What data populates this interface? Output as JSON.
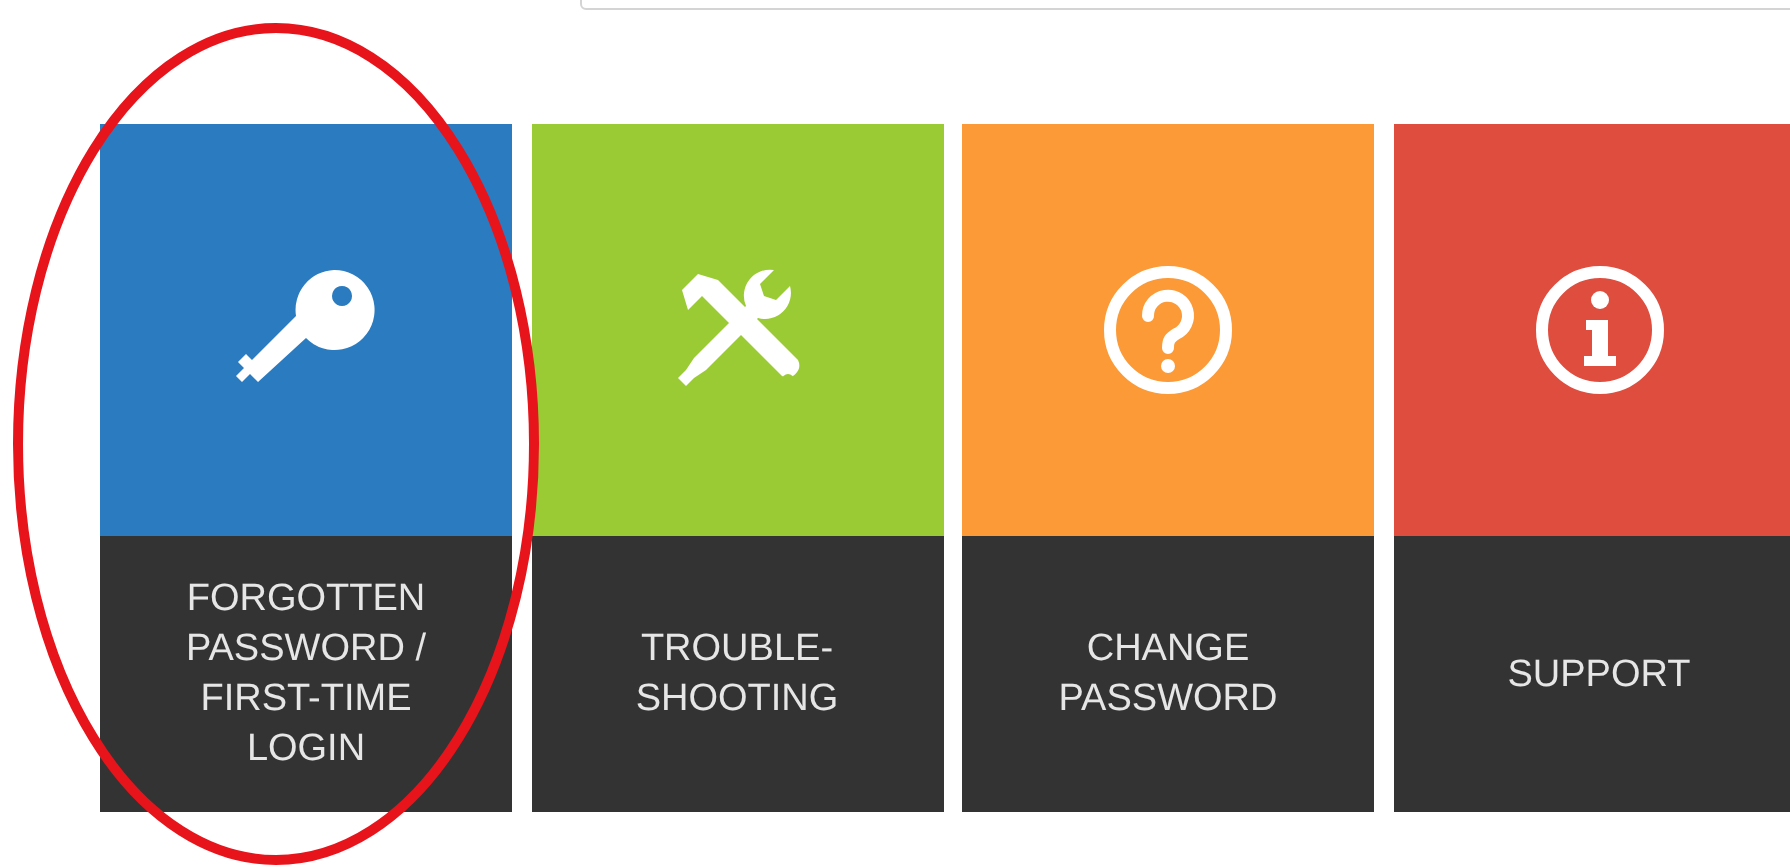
{
  "tiles": [
    {
      "label": "FORGOTTEN PASSWORD / FIRST-TIME LOGIN",
      "color": "#2a7bc0",
      "circled": true
    },
    {
      "label": "TROUBLE-SHOOTING",
      "color": "#9acb34",
      "circled": false
    },
    {
      "label": "CHANGE PASSWORD",
      "color": "#fb9a37",
      "circled": false
    },
    {
      "label": "SUPPORT",
      "color": "#df4d3f",
      "circled": false
    }
  ]
}
